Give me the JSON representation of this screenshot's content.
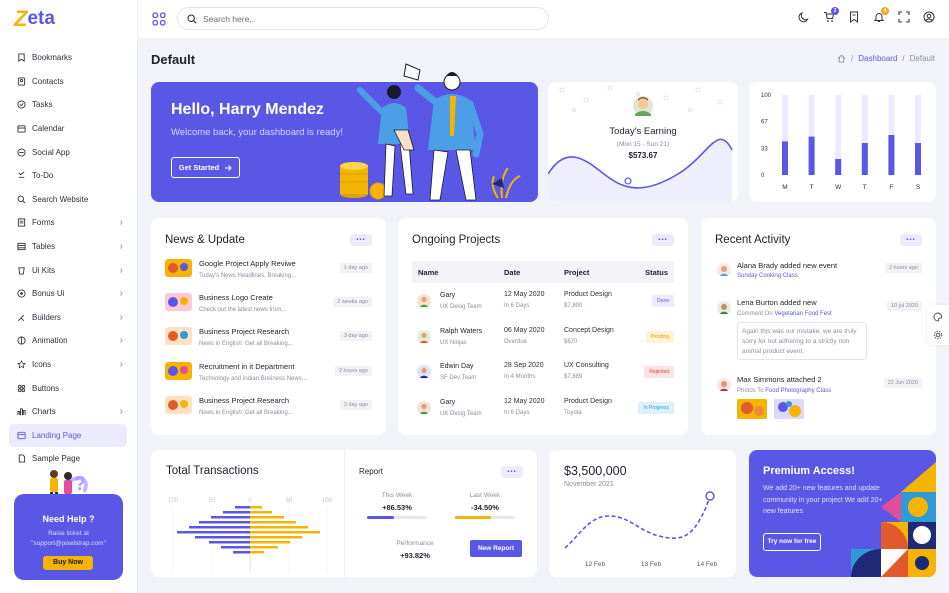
{
  "brand": {
    "name": "eta",
    "mark": "Z"
  },
  "sidebar": {
    "items": [
      {
        "label": "Bookmarks",
        "icon": "bookmark-icon",
        "chevron": false
      },
      {
        "label": "Contacts",
        "icon": "contact-icon",
        "chevron": false
      },
      {
        "label": "Tasks",
        "icon": "task-icon",
        "chevron": false
      },
      {
        "label": "Calendar",
        "icon": "calendar-icon",
        "chevron": false
      },
      {
        "label": "Social App",
        "icon": "social-icon",
        "chevron": false
      },
      {
        "label": "To-Do",
        "icon": "todo-icon",
        "chevron": false
      },
      {
        "label": "Search Website",
        "icon": "search-icon",
        "chevron": false
      },
      {
        "label": "Forms",
        "icon": "forms-icon",
        "chevron": true
      },
      {
        "label": "Tables",
        "icon": "tables-icon",
        "chevron": true
      },
      {
        "label": "Ui Kits",
        "icon": "ui-kits-icon",
        "chevron": true
      },
      {
        "label": "Bonus Ui",
        "icon": "bonus-icon",
        "chevron": true
      },
      {
        "label": "Builders",
        "icon": "builders-icon",
        "chevron": true
      },
      {
        "label": "Animation",
        "icon": "animation-icon",
        "chevron": true
      },
      {
        "label": "Icons",
        "icon": "icons-icon",
        "chevron": true
      },
      {
        "label": "Buttons",
        "icon": "buttons-icon",
        "chevron": false
      },
      {
        "label": "Charts",
        "icon": "charts-icon",
        "chevron": true
      },
      {
        "label": "Landing Page",
        "icon": "landing-icon",
        "chevron": false,
        "active": true
      },
      {
        "label": "Sample Page",
        "icon": "sample-icon",
        "chevron": false
      }
    ],
    "help": {
      "title": "Need Help ?",
      "line1": "Raise ticket at",
      "line2": "\"support@pixelstrap.com\"",
      "button": "Buy Now"
    }
  },
  "topbar": {
    "search_placeholder": "Search here..",
    "cart_badge": "2",
    "bell_badge": "4",
    "colors": {
      "cart_badge": "#5b57e6",
      "bell_badge": "#f5a623"
    }
  },
  "page": {
    "title": "Default",
    "breadcrumb": [
      "Dashboard",
      "Default"
    ]
  },
  "hero": {
    "greeting": "Hello, Harry Mendez",
    "message": "Welcome back, your dashboard is ready!",
    "button": "Get Started"
  },
  "earning": {
    "title": "Today's Earning",
    "range": "(Mon 15 - Sun 21)",
    "amount": "$573.67"
  },
  "weekly_chart": {
    "type": "bar",
    "categories": [
      "M",
      "T",
      "W",
      "T",
      "F",
      "S"
    ],
    "values": [
      42,
      48,
      20,
      40,
      50,
      40
    ],
    "ylim": [
      0,
      100
    ],
    "ticks": [
      "100",
      "67",
      "33",
      "0"
    ],
    "color": "#5b57e6"
  },
  "news": {
    "title": "News & Update",
    "items": [
      {
        "title": "Google Project Apply Reviwe",
        "sub": "Today's News Headlines, Breaking...",
        "time": "1 day ago"
      },
      {
        "title": "Business Logo Create",
        "sub": "Check out the latest news from...",
        "time": "2 weeks ago"
      },
      {
        "title": "Business Project Research",
        "sub": "News in English: Get all Breaking...",
        "time": "3 day ago"
      },
      {
        "title": "Recruitment in it Department",
        "sub": "Technology and Indian Business News...",
        "time": "2 hours ago"
      },
      {
        "title": "Business Project Research",
        "sub": "News in English: Get all Breaking...",
        "time": "3 day ago"
      }
    ]
  },
  "projects": {
    "title": "Ongoing Projects",
    "columns": [
      "Name",
      "Date",
      "Project",
      "Status"
    ],
    "rows": [
      {
        "name": "Gary",
        "role": "UK Desig Team",
        "date": "12 May 2020",
        "duration": "In 6 Days",
        "project": "Product Design",
        "value": "$7,800",
        "status": "Done",
        "status_color": "#5b57e6",
        "status_bg": "#ecebfd"
      },
      {
        "name": "Ralph Waters",
        "role": "UX Ninjas",
        "date": "06 May 2020",
        "duration": "Overdue",
        "project": "Concept Design",
        "value": "$670",
        "status": "Pending",
        "status_color": "#e4a300",
        "status_bg": "#fff3d6"
      },
      {
        "name": "Edwin Day",
        "role": "SF Dev Team",
        "date": "28 Sep 2020",
        "duration": "In 4 Months",
        "project": "UX Consulting",
        "value": "$7,889",
        "status": "Rejected",
        "status_color": "#e23b3b",
        "status_bg": "#fde3e3"
      },
      {
        "name": "Gary",
        "role": "UK Desig Team",
        "date": "12 May 2020",
        "duration": "In 6 Days",
        "project": "Product Design",
        "value": "Toyota",
        "status": "In Progress",
        "status_color": "#2f9bd6",
        "status_bg": "#def1fb"
      }
    ]
  },
  "activity": {
    "title": "Recent Activity",
    "items": [
      {
        "title": "Alana Brady added new event",
        "sub": "",
        "sub_highlight": "Sunday Cooking Class",
        "time": "2 hours ago"
      },
      {
        "title": "Lena Burton added new",
        "sub": "Comment On ",
        "sub_highlight": "Vegetarian Food Fest",
        "time": "10 jul 2020",
        "quote": "Again this was our mistake, we are truly sorry for not adhering to a strictly non animal product event."
      },
      {
        "title": "Max Simmons attached 2",
        "sub": "Photos To ",
        "sub_highlight": "Food Photography Class",
        "time": "22 Jun 2020"
      }
    ]
  },
  "transactions": {
    "title": "Total Transactions",
    "axis_ticks": [
      "100",
      "50",
      "0",
      "50",
      "100"
    ],
    "report_title": "Report",
    "this_week_label": "This Week",
    "this_week_value": "+86.53%",
    "this_week_progress": 0.45,
    "last_week_label": "Last Week",
    "last_week_value": "-34.50%",
    "last_week_progress": 0.6,
    "performance_label": "Performance",
    "performance_value": "+93.82%",
    "button": "New Report"
  },
  "revenue": {
    "amount": "$3,500,000",
    "period": "November 2021",
    "x_labels": [
      "12 Feb",
      "13 Feb",
      "14 Feb"
    ]
  },
  "premium": {
    "title": "Premium Access!",
    "desc": "We add 20+ new features and update community in your project We add 20+ new features",
    "button": "Try now for free"
  }
}
